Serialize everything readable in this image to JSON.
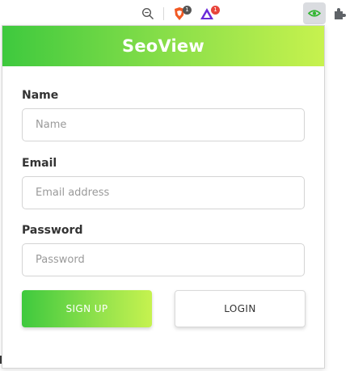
{
  "browser": {
    "brave_badge": "1",
    "rewards_badge": "1"
  },
  "popup": {
    "title": "SeoView",
    "name": {
      "label": "Name",
      "placeholder": "Name",
      "value": ""
    },
    "email": {
      "label": "Email",
      "placeholder": "Email address",
      "value": ""
    },
    "password": {
      "label": "Password",
      "placeholder": "Password",
      "value": ""
    },
    "signup_label": "SIGN UP",
    "login_label": "LOGIN"
  },
  "colors": {
    "brand_gradient_start": "#3ec93e",
    "brand_gradient_end": "#c7f24e",
    "text": "#333333",
    "placeholder": "#9a9a9a"
  },
  "icons": [
    "zoom-icon",
    "brave-shields-icon",
    "brave-rewards-icon",
    "seoview-extension-icon",
    "extensions-puzzle-icon"
  ]
}
